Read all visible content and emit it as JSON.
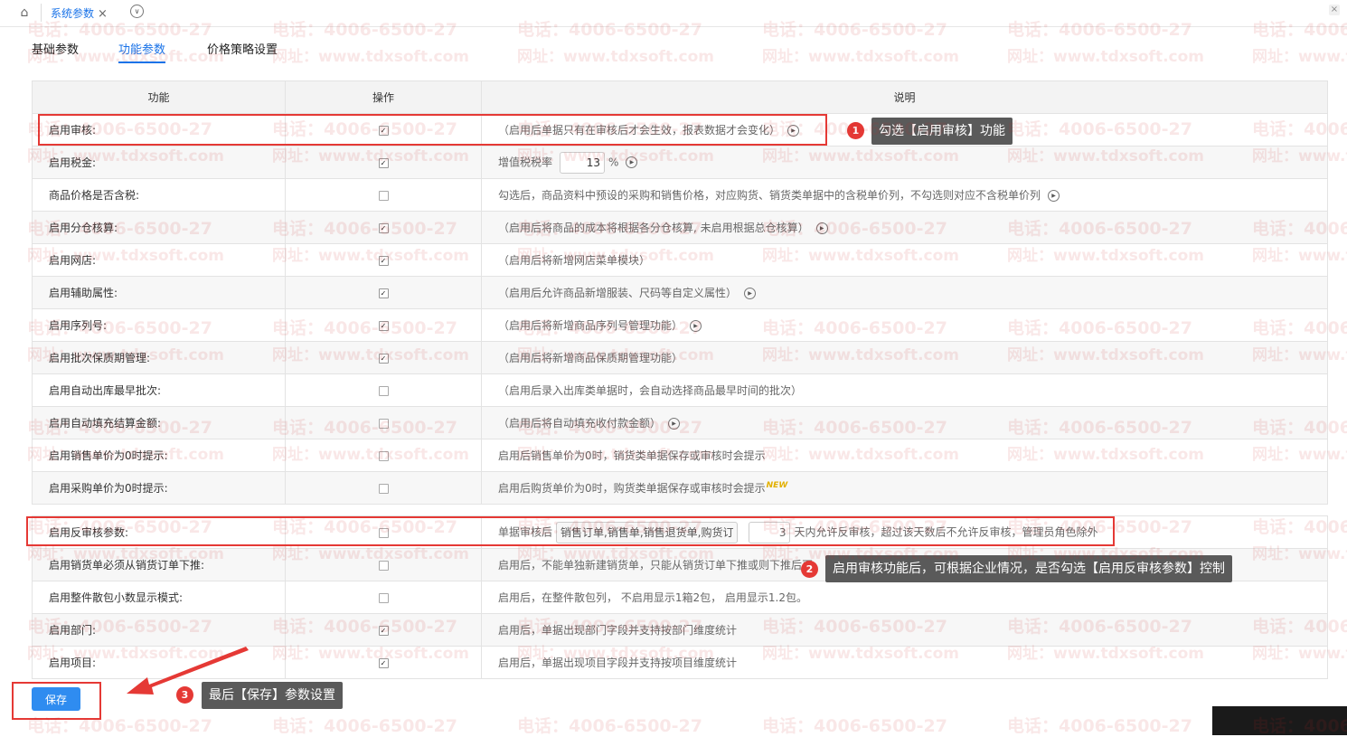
{
  "topbar": {
    "tab_title": "系统参数",
    "close": "×"
  },
  "subtabs": [
    "基础参数",
    "功能参数",
    "价格策略设置"
  ],
  "table": {
    "headers": {
      "feature": "功能",
      "op": "操作",
      "desc": "说明"
    },
    "rows": [
      {
        "feature": "启用审核:",
        "checked": true,
        "desc": "（启用后单据只有在审核后才会生效，报表数据才会变化）",
        "play": true
      },
      {
        "feature": "启用税金:",
        "checked": true,
        "desc_prefix": "增值税税率",
        "rate": "13",
        "rate_unit": "%",
        "play": true
      },
      {
        "feature": "商品价格是否含税:",
        "checked": false,
        "desc": "勾选后，商品资料中预设的采购和销售价格，对应购货、销货类单据中的含税单价列，不勾选则对应不含税单价列",
        "play": true
      },
      {
        "feature": "启用分仓核算:",
        "checked": true,
        "desc": "（启用后将商品的成本将根据各分仓核算, 未启用根据总仓核算）",
        "play": true
      },
      {
        "feature": "启用网店:",
        "checked": true,
        "desc": "（启用后将新增网店菜单模块）",
        "play": false
      },
      {
        "feature": "启用辅助属性:",
        "checked": true,
        "desc": "（启用后允许商品新增服装、尺码等自定义属性）",
        "play": true
      },
      {
        "feature": "启用序列号:",
        "checked": true,
        "desc": "（启用后将新增商品序列号管理功能）",
        "play": true
      },
      {
        "feature": "启用批次保质期管理:",
        "checked": true,
        "desc": "（启用后将新增商品保质期管理功能）",
        "play": false
      },
      {
        "feature": "启用自动出库最早批次:",
        "checked": false,
        "desc": "（启用后录入出库类单据时，会自动选择商品最早时间的批次）",
        "play": false
      },
      {
        "feature": "启用自动填充结算金额:",
        "checked": false,
        "desc": "（启用后将自动填充收付款金额）",
        "play": true
      },
      {
        "feature": "启用销售单价为0时提示:",
        "checked": false,
        "desc": "启用后销售单价为0时，销货类单据保存或审核时会提示",
        "play": false
      },
      {
        "feature": "启用采购单价为0时提示:",
        "checked": false,
        "desc": "启用后购货单价为0时，购货类单据保存或审核时会提示",
        "badge": "NEW",
        "play": false
      }
    ],
    "rows2": [
      {
        "feature": "启用反审核参数:",
        "checked": false,
        "desc_prefix": "单据审核后",
        "select_value": "销售订单,销售单,销售退货单,购货订",
        "days": "3",
        "desc_suffix": "天内允许反审核，超过该天数后不允许反审核，管理员角色除外"
      },
      {
        "feature": "启用销货单必须从销货订单下推:",
        "checked": false,
        "desc": "启用后，不能单独新建销货单，只能从销货订单下推或则下推后再"
      },
      {
        "feature": "启用整件散包小数显示模式:",
        "checked": false,
        "desc": "启用后，在整件散包列， 不启用显示1箱2包， 启用显示1.2包。"
      },
      {
        "feature": "启用部门:",
        "checked": true,
        "desc": "启用后，单据出现部门字段并支持按部门维度统计"
      },
      {
        "feature": "启用项目:",
        "checked": true,
        "desc": "启用后，单据出现项目字段并支持按项目维度统计"
      }
    ]
  },
  "save_button": "保存",
  "annotations": [
    {
      "num": "1",
      "text": "勾选【启用审核】功能"
    },
    {
      "num": "2",
      "text": "启用审核功能后，可根据企业情况，是否勾选【启用反审核参数】控制"
    },
    {
      "num": "3",
      "text": "最后【保存】参数设置"
    }
  ],
  "watermark": {
    "phone": "电话：4006-6500-27",
    "site": "网址：www.tdxsoft.com"
  },
  "colors": {
    "accent": "#1a73e8",
    "annotation_red": "#e53935",
    "tip_bg": "#5a5a5a",
    "save_blue": "#2f8cf0"
  }
}
